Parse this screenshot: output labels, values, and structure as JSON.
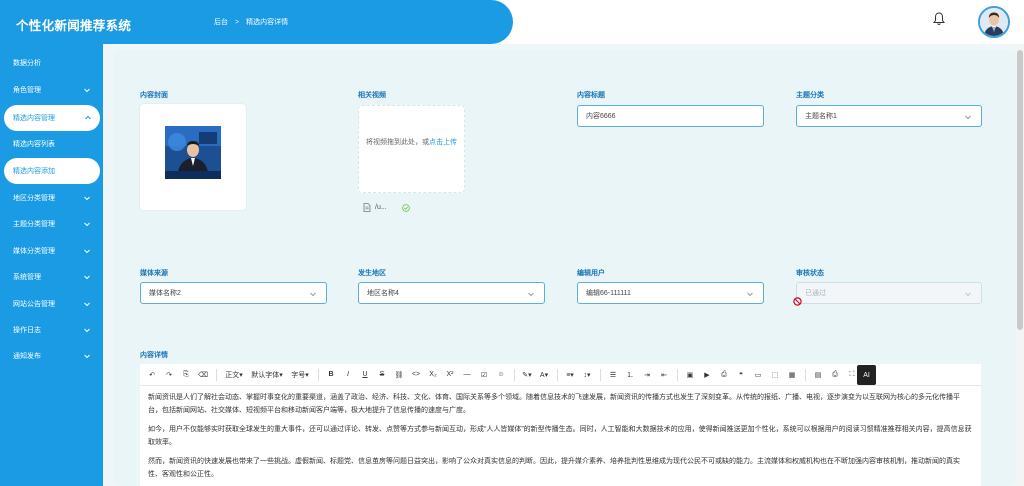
{
  "header": {
    "app_title": "个性化新闻推荐系统",
    "breadcrumb": [
      "后台",
      "精选内容详情"
    ]
  },
  "sidebar": {
    "items": [
      {
        "label": "数据分析",
        "expandable": false
      },
      {
        "label": "角色管理",
        "expandable": true
      },
      {
        "label": "精选内容管理",
        "expandable": true,
        "expanded": true
      },
      {
        "label": "精选内容列表",
        "expandable": false
      },
      {
        "label": "精选内容添加",
        "expandable": false,
        "selected": true
      },
      {
        "label": "地区分类管理",
        "expandable": true
      },
      {
        "label": "主题分类管理",
        "expandable": true
      },
      {
        "label": "媒体分类管理",
        "expandable": true
      },
      {
        "label": "系统管理",
        "expandable": true
      },
      {
        "label": "网站公告管理",
        "expandable": true
      },
      {
        "label": "操作日志",
        "expandable": true
      },
      {
        "label": "通知发布",
        "expandable": true
      }
    ]
  },
  "form": {
    "cover_label": "内容封面",
    "video_label": "相关视频",
    "video_upload_text": "将视频拖到此处，或",
    "video_upload_link": "点击上传",
    "video_file_name": "/u...",
    "title_label": "内容标题",
    "title_value": "内容6666",
    "topic_label": "主题分类",
    "topic_value": "主题名称1",
    "media_label": "媒体来源",
    "media_value": "媒体名称2",
    "region_label": "发生地区",
    "region_value": "地区名称4",
    "editor_user_label": "编辑用户",
    "editor_user_value": "编辑66-111111",
    "review_label": "审核状态",
    "review_value": "已通过",
    "detail_label": "内容详情"
  },
  "editor": {
    "toolbar": {
      "paragraph": "正文",
      "font_family": "默认字体",
      "font_size": "字号",
      "ai": "AI"
    },
    "paragraphs": [
      "新闻资讯是人们了解社会动态、掌握时事变化的重要渠道，涵盖了政治、经济、科技、文化、体育、国际关系等多个领域。随着信息技术的飞速发展，新闻资讯的传播方式也发生了深刻变革。从传统的报纸、广播、电视，逐步演变为以互联网为核心的多元化传播平台，包括新闻网站、社交媒体、短视频平台和移动新闻客户端等，极大地提升了信息传播的速度与广度。",
      "如今，用户不仅能够实时获取全球发生的重大事件，还可以通过评论、转发、点赞等方式参与新闻互动，形成“人人皆媒体”的新型传播生态。同时，人工智能和大数据技术的应用，使得新闻推送更加个性化，系统可以根据用户的阅读习惯精准推荐相关内容，提高信息获取效率。",
      "然而，新闻资讯的快速发展也带来了一些挑战。虚假新闻、标题党、信息茧房等问题日益突出，影响了公众对真实信息的判断。因此，提升媒介素养、培养批判性思维成为现代公民不可或缺的能力。主流媒体和权威机构也在不断加强内容审核机制，推动新闻的真实性、客观性和公正性。"
    ]
  }
}
